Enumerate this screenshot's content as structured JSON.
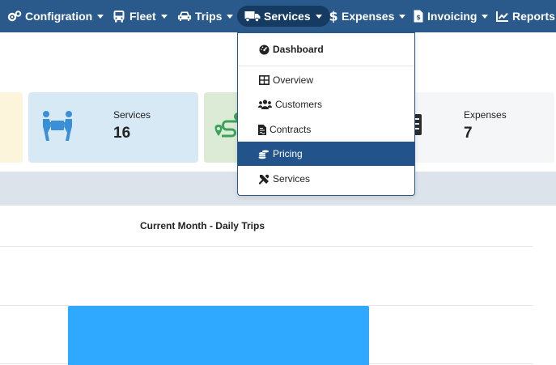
{
  "navbar": {
    "items": [
      {
        "label": "Configration",
        "icon": "cogs-icon",
        "caret": true
      },
      {
        "label": "Fleet",
        "icon": "bus-icon",
        "caret": true
      },
      {
        "label": "Trips",
        "icon": "car-icon",
        "caret": true
      },
      {
        "label": "Services",
        "icon": "truck-icon",
        "caret": true,
        "active": true
      },
      {
        "label": "Expenses",
        "icon": "dollar-icon",
        "caret": true
      },
      {
        "label": "Invoicing",
        "icon": "invoice-icon",
        "caret": true
      },
      {
        "label": "Reports",
        "icon": "chart-line-icon",
        "caret": false
      }
    ]
  },
  "cards": {
    "services": {
      "label": "Services",
      "value": "16",
      "icon": "people-carry-icon"
    },
    "expenses": {
      "label": "Expenses",
      "value": "7"
    }
  },
  "chart": {
    "title": "Current Month - Daily Trips"
  },
  "chart_data": {
    "type": "bar",
    "title": "Current Month - Daily Trips",
    "categories": [
      ""
    ],
    "values": [
      1
    ]
  },
  "dropdown": {
    "items": [
      {
        "label": "Dashboard",
        "icon": "tachometer-icon",
        "bold": true
      },
      {
        "label": "Overview",
        "icon": "table-icon"
      },
      {
        "label": "Customers",
        "icon": "users-icon"
      },
      {
        "label": "Contracts",
        "icon": "file-contract-icon"
      },
      {
        "label": "Pricing",
        "icon": "coins-icon",
        "selected": true
      },
      {
        "label": "Services",
        "icon": "tools-icon"
      }
    ]
  },
  "colors": {
    "navbar": "#2a5a8c",
    "active_nav": "#163b63",
    "selected_item": "#22538a",
    "bar": "#2fa8ff",
    "card_blue": "#d7e9f4",
    "card_green": "#dcebd5",
    "card_yellow": "#fdf4dc",
    "icon_blue": "#3a8fd6",
    "icon_green": "#3aa35a"
  }
}
